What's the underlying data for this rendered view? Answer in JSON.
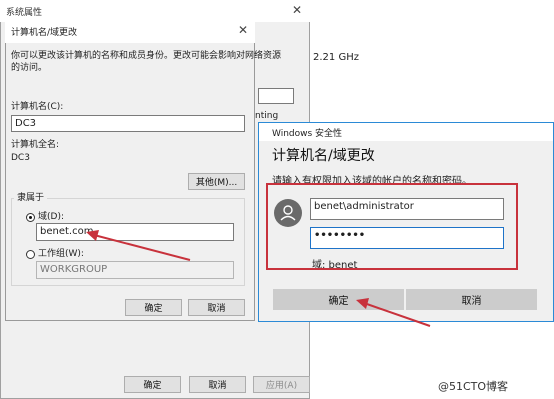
{
  "system_window": {
    "title": "系统属性",
    "close_glyph": "✕",
    "cpu_fragment": "2.21 GHz",
    "text_fragment": "nting",
    "buttons": {
      "ok": "确定",
      "cancel": "取消",
      "apply": "应用(A)"
    }
  },
  "name_dialog": {
    "title": "计算机名/域更改",
    "close_glyph": "✕",
    "intro_line1": "你可以更改该计算机的名称和成员身份。更改可能会影响对网络资源",
    "intro_line2": "的访问。",
    "computer_name_label": "计算机名(C):",
    "computer_name_value": "DC3",
    "full_name_label": "计算机全名:",
    "full_name_value": "DC3",
    "other_button": "其他(M)...",
    "member_of_label": "隶属于",
    "domain_label": "域(D):",
    "domain_value": "benet.com",
    "workgroup_label": "工作组(W):",
    "workgroup_value": "WORKGROUP",
    "ok": "确定",
    "cancel": "取消"
  },
  "security_dialog": {
    "title": "Windows 安全性",
    "heading": "计算机名/域更改",
    "description": "请输入有权限加入该域的帐户的名称和密码。",
    "username": "benet\\administrator",
    "password_mask": "••••••••",
    "domain_line": "域: benet",
    "ok": "确定",
    "cancel": "取消"
  },
  "watermark": "@51CTO博客",
  "colors": {
    "highlight_red": "#c8323c",
    "arrow_red": "#c8323c",
    "focus_blue": "#1e73c8"
  }
}
